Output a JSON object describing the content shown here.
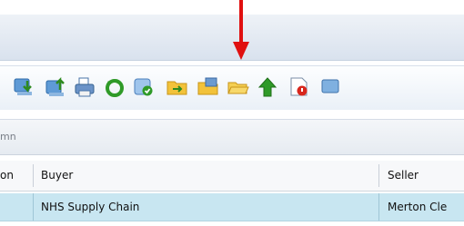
{
  "toolbar": {
    "buttons": [
      {
        "icon": "import-down-icon"
      },
      {
        "icon": "export-up-icon"
      },
      {
        "icon": "print-icon"
      },
      {
        "icon": "refresh-recycle-icon"
      },
      {
        "icon": "document-ok-icon"
      },
      {
        "icon": "folder-arrow-icon"
      },
      {
        "icon": "folder-edit-icon"
      },
      {
        "icon": "folder-open-icon"
      },
      {
        "icon": "green-up-arrow-icon"
      },
      {
        "icon": "document-stop-icon"
      },
      {
        "icon": "document-blue-icon"
      }
    ]
  },
  "grid": {
    "group_hint": "mn",
    "columns": {
      "prev_fragment": "on",
      "buyer": "Buyer",
      "seller": "Seller"
    },
    "rows": [
      {
        "buyer": "NHS Supply Chain",
        "seller": "Merton Cle"
      }
    ]
  },
  "annotation": {
    "arrow_color": "#e01010"
  }
}
